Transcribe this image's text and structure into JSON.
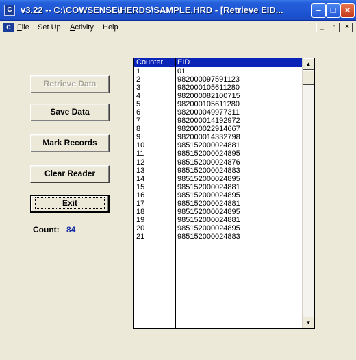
{
  "window": {
    "title": "v3.22 -- C:\\COWSENSE\\HERDS\\SAMPLE.HRD - [Retrieve EID...",
    "app_icon": "C",
    "minimize": "–",
    "maximize": "□",
    "close": "×"
  },
  "menubar": {
    "icon": "C",
    "items": [
      {
        "label": "File",
        "underline": "F",
        "rest": "ile"
      },
      {
        "label": "Set Up"
      },
      {
        "label": "Activity",
        "underline": "A",
        "rest": "ctivity"
      },
      {
        "label": "Help"
      }
    ],
    "doc_min": "_",
    "doc_restore": "▫",
    "doc_close": "×"
  },
  "buttons": {
    "retrieve": "Retrieve Data",
    "save": "Save Data",
    "mark": "Mark Records",
    "clear": "Clear Reader",
    "exit": "Exit"
  },
  "count": {
    "label": "Count:",
    "value": "84"
  },
  "grid": {
    "columns": [
      "Counter",
      "EID"
    ],
    "rows": [
      [
        "1",
        "01"
      ],
      [
        "2",
        "982000097591123"
      ],
      [
        "3",
        "982000105611280"
      ],
      [
        "4",
        "982000082100715"
      ],
      [
        "5",
        "982000105611280"
      ],
      [
        "6",
        "982000049977311"
      ],
      [
        "7",
        "982000014192972"
      ],
      [
        "8",
        "982000022914667"
      ],
      [
        "9",
        "982000014332798"
      ],
      [
        "10",
        "985152000024881"
      ],
      [
        "11",
        "985152000024895"
      ],
      [
        "12",
        "985152000024876"
      ],
      [
        "13",
        "985152000024883"
      ],
      [
        "14",
        "985152000024895"
      ],
      [
        "15",
        "985152000024881"
      ],
      [
        "16",
        "985152000024895"
      ],
      [
        "17",
        "985152000024881"
      ],
      [
        "18",
        "985152000024895"
      ],
      [
        "19",
        "985152000024881"
      ],
      [
        "20",
        "985152000024895"
      ],
      [
        "21",
        "985152000024883"
      ]
    ]
  },
  "scrollbar": {
    "up": "▲",
    "down": "▼"
  },
  "colors": {
    "titlebar": "#245edb",
    "header": "#0a24b8",
    "count_value": "#1a2fa5"
  }
}
